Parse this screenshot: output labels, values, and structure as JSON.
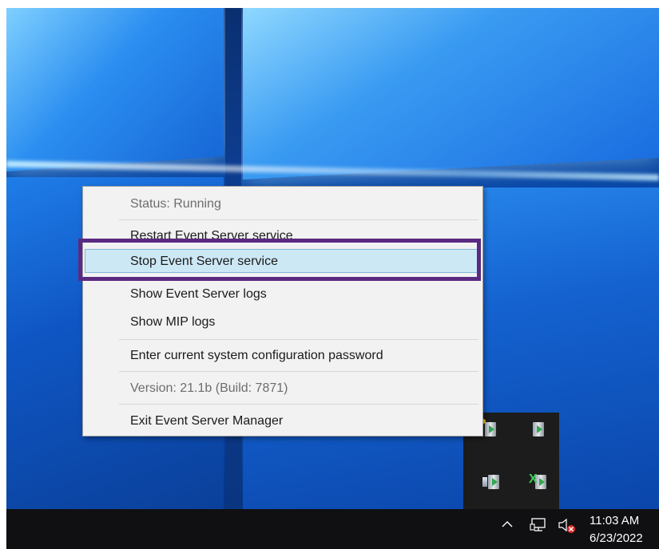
{
  "menu": {
    "status": "Status: Running",
    "restart": "Restart Event Server service",
    "stop": "Stop Event Server service",
    "show_logs": "Show Event Server logs",
    "show_mip_logs": "Show MIP logs",
    "enter_password": "Enter current system configuration password",
    "version": "Version: 21.1b (Build: 7871)",
    "exit": "Exit Event Server Manager"
  },
  "taskbar": {
    "time": "11:03 AM",
    "date": "6/23/2022"
  },
  "icons": {
    "tray_overflow": "chevron-up-icon",
    "network": "network-icon",
    "volume": "volume-muted-icon",
    "event_server_tray": "event-server-icon"
  },
  "colors": {
    "highlight_frame": "#5a2a82",
    "menu_hover": "#cde8f5",
    "taskbar": "#101012"
  }
}
